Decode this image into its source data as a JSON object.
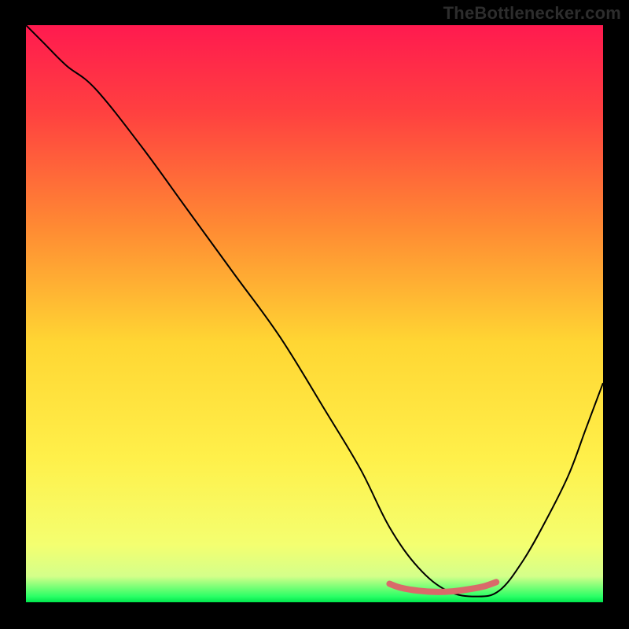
{
  "watermark": "TheBottlenecker.com",
  "colors": {
    "background": "#000000",
    "curve_stroke": "#000000",
    "marker_stroke": "#d96a6a",
    "gradient_stops": [
      {
        "offset": 0.0,
        "color": "#ff1a4f"
      },
      {
        "offset": 0.15,
        "color": "#ff4040"
      },
      {
        "offset": 0.35,
        "color": "#ff8a33"
      },
      {
        "offset": 0.55,
        "color": "#ffd633"
      },
      {
        "offset": 0.75,
        "color": "#fff04a"
      },
      {
        "offset": 0.9,
        "color": "#f4ff70"
      },
      {
        "offset": 0.955,
        "color": "#d4ff8a"
      },
      {
        "offset": 0.99,
        "color": "#2aff66"
      },
      {
        "offset": 1.0,
        "color": "#00e64d"
      }
    ]
  },
  "chart_data": {
    "type": "line",
    "title": "",
    "xlabel": "",
    "ylabel": "",
    "xlim": [
      0,
      1
    ],
    "ylim": [
      0,
      1
    ],
    "series": [
      {
        "name": "bottleneck-curve",
        "x": [
          0.0,
          0.03,
          0.07,
          0.12,
          0.2,
          0.28,
          0.36,
          0.44,
          0.52,
          0.58,
          0.63,
          0.68,
          0.73,
          0.78,
          0.82,
          0.86,
          0.9,
          0.94,
          0.97,
          1.0
        ],
        "y": [
          1.0,
          0.97,
          0.93,
          0.89,
          0.79,
          0.68,
          0.57,
          0.46,
          0.33,
          0.23,
          0.13,
          0.06,
          0.02,
          0.01,
          0.02,
          0.07,
          0.14,
          0.22,
          0.3,
          0.38
        ]
      },
      {
        "name": "optimal-region-marker",
        "x": [
          0.63,
          0.65,
          0.68,
          0.71,
          0.74,
          0.77,
          0.795,
          0.815
        ],
        "y": [
          0.032,
          0.025,
          0.02,
          0.018,
          0.019,
          0.023,
          0.028,
          0.035
        ]
      }
    ],
    "annotations": []
  }
}
